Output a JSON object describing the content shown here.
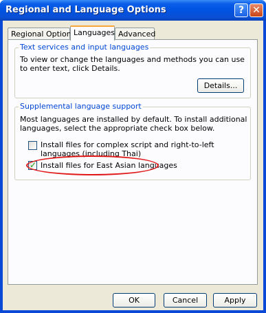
{
  "window": {
    "title": "Regional and Language Options",
    "help_glyph": "?",
    "close_glyph": "✕"
  },
  "tabs": [
    {
      "label": "Regional Options",
      "active": false
    },
    {
      "label": "Languages",
      "active": true
    },
    {
      "label": "Advanced",
      "active": false
    }
  ],
  "text_services": {
    "legend": "Text services and input languages",
    "description": "To view or change the languages and methods you can use to enter text, click Details.",
    "details_button": "Details..."
  },
  "supplemental": {
    "legend": "Supplemental language support",
    "description": "Most languages are installed by default. To install additional languages, select the appropriate check box below.",
    "complex_script": {
      "label": "Install files for complex script and right-to-left languages (including Thai)",
      "checked": false
    },
    "east_asian": {
      "label": "Install files for East Asian languages",
      "checked": true
    }
  },
  "footer": {
    "ok": "OK",
    "cancel": "Cancel",
    "apply": "Apply"
  },
  "colors": {
    "titlebar": "#0054e3",
    "legend_text": "#0046d5",
    "annotation": "#e01818"
  }
}
